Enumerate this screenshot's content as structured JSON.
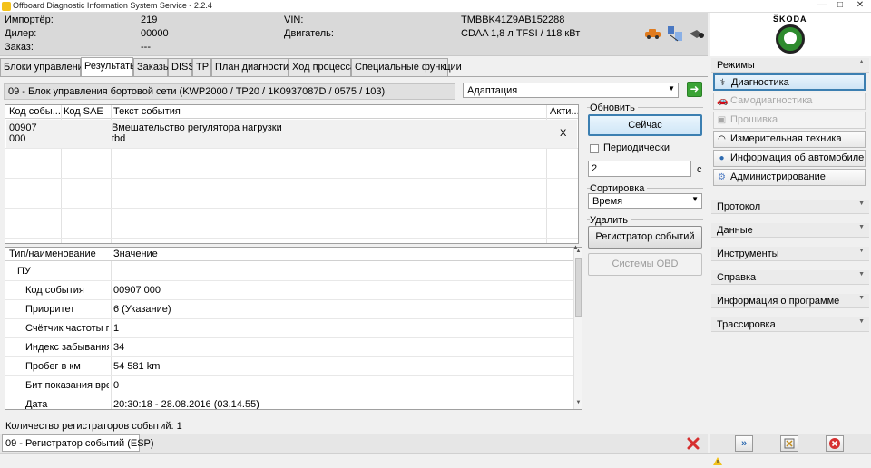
{
  "window": {
    "title": "Offboard Diagnostic Information System Service - 2.2.4",
    "minimize": "—",
    "maximize": "□",
    "close": "✕"
  },
  "header": {
    "importer_label": "Импортёр:",
    "importer_value": "219",
    "dealer_label": "Дилер:",
    "dealer_value": "00000",
    "order_label": "Заказ:",
    "order_value": "---",
    "vin_label": "VIN:",
    "vin_value": "TMBBK41Z9AB152288",
    "engine_label": "Двигатель:",
    "engine_value": "CDAA 1,8 л TFSI / 118 кВт",
    "brand": "ŠKODA",
    "icons": [
      "car-connection-icon",
      "network-icon",
      "cable-icon"
    ]
  },
  "tabs": [
    "Блоки управления",
    "Результаты",
    "Заказы",
    "DISS",
    "TPI",
    "План диагностики",
    "Ход процесса",
    "Специальные функции"
  ],
  "ecu": {
    "title": "09 - Блок управления бортовой сети  (KWP2000 / TP20 / 1K0937087D  / 0575 / 103)",
    "mode_value": "Адаптация",
    "go_symbol": "➜"
  },
  "events_table": {
    "columns": [
      "Код собы...",
      "Код SAE",
      "Текст события",
      "Акти..."
    ],
    "rows": [
      {
        "code_line1": "00907",
        "code_line2": "000",
        "sae": "",
        "text_line1": "Вмешательство регулятора нагрузки",
        "text_line2": "tbd",
        "active": "X"
      }
    ]
  },
  "details_table": {
    "columns": [
      "Тип/наименование",
      "Значение"
    ],
    "rows": [
      {
        "name": "ПУ",
        "value": ""
      },
      {
        "name": "Код события",
        "value": "00907 000"
      },
      {
        "name": "Приоритет",
        "value": "6  (Указание)"
      },
      {
        "name": "Счётчик частоты проявления",
        "value": "1"
      },
      {
        "name": "Индекс забывания / ...",
        "value": "34"
      },
      {
        "name": "Пробег в км",
        "value": "54 581 km"
      },
      {
        "name": "Бит показания времени",
        "value": "0"
      },
      {
        "name": "Дата",
        "value": "20:30:18 - 28.08.2016  (03.14.55)"
      }
    ]
  },
  "refresh": {
    "title": "Обновить",
    "now_button": "Сейчас",
    "periodic_label": "Периодически",
    "interval_value": "2",
    "interval_unit": "с"
  },
  "sorting": {
    "title": "Сортировка",
    "value": "Время"
  },
  "delete": {
    "title": "Удалить",
    "event_recorder_button": "Регистратор событий",
    "obd_button": "Системы OBD"
  },
  "status": {
    "count_text": "Количество регистраторов событий:  1",
    "bottom_tab": "09 - Регистратор событий (ESP)"
  },
  "right_panel": {
    "modes_title": "Режимы",
    "modes": [
      {
        "label": "Диагностика",
        "icon": "stethoscope-icon",
        "state": "active"
      },
      {
        "label": "Самодиагностика",
        "icon": "car-icon",
        "state": "disabled"
      },
      {
        "label": "Прошивка",
        "icon": "chip-icon",
        "state": "disabled"
      },
      {
        "label": "Измерительная техника",
        "icon": "gauge-icon",
        "state": "normal"
      },
      {
        "label": "Информация об автомобиле",
        "icon": "info-car-icon",
        "state": "normal"
      },
      {
        "label": "Администрирование",
        "icon": "gear-icon",
        "state": "normal"
      }
    ],
    "sections": [
      "Протокол",
      "Данные",
      "Инструменты",
      "Справка",
      "Информация о программе",
      "Трассировка"
    ]
  },
  "colors": {
    "accent": "#3c7fb1",
    "go": "#3aa335",
    "cancel": "#d62f2f"
  }
}
